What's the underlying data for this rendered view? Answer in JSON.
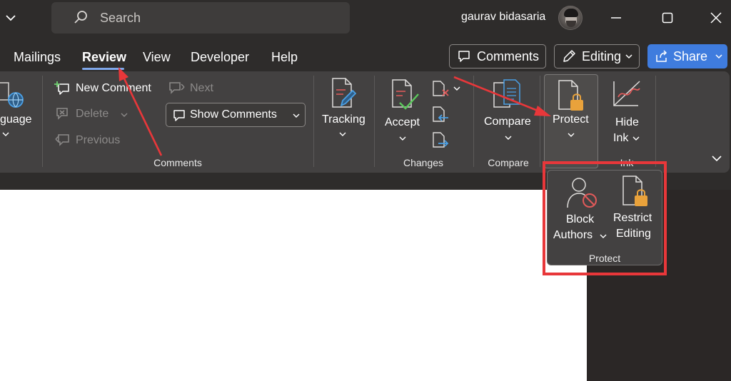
{
  "titlebar": {
    "search_placeholder": "Search",
    "username": "gaurav bidasaria"
  },
  "tabs": [
    {
      "label": "Mailings"
    },
    {
      "label": "Review",
      "active": true
    },
    {
      "label": "View"
    },
    {
      "label": "Developer"
    },
    {
      "label": "Help"
    }
  ],
  "toolbar": {
    "comments_label": "Comments",
    "editing_label": "Editing",
    "share_label": "Share"
  },
  "ribbon": {
    "language_label": "guage",
    "comments_group": {
      "new_comment": "New Comment",
      "delete": "Delete",
      "previous": "Previous",
      "next": "Next",
      "show_comments": "Show Comments",
      "label": "Comments"
    },
    "tracking_label": "Tracking",
    "changes_group": {
      "accept": "Accept",
      "label": "Changes"
    },
    "compare_group": {
      "compare": "Compare",
      "label": "Compare"
    },
    "protect_label": "Protect",
    "ink_group": {
      "hide": "Hide",
      "ink": "Ink",
      "label": "Ink"
    }
  },
  "protect_dropdown": {
    "block": "Block",
    "authors": "Authors",
    "restrict": "Restrict",
    "editing": "Editing",
    "label": "Protect"
  },
  "colors": {
    "accent": "#3f7cde",
    "tab_underline": "#7fa7ea",
    "annotation_red": "#e8373a",
    "lock": "#e9a23b"
  }
}
